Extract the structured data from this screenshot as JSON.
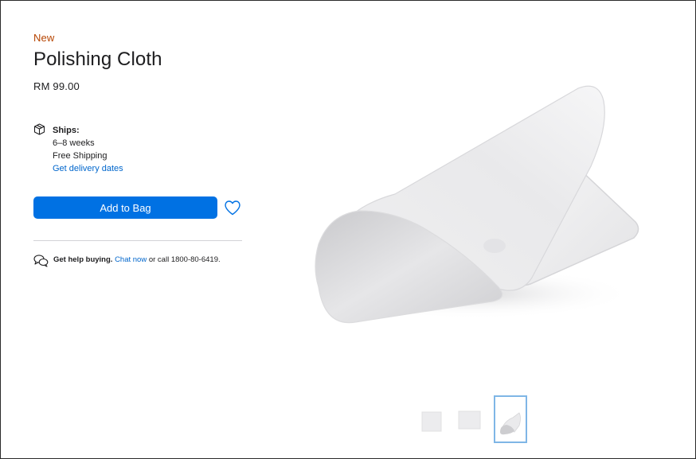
{
  "product": {
    "badge": "New",
    "title": "Polishing Cloth",
    "price": "RM 99.00"
  },
  "shipping": {
    "icon": "box-icon",
    "title": "Ships:",
    "duration": "6–8 weeks",
    "cost": "Free Shipping",
    "delivery_link": "Get delivery dates"
  },
  "actions": {
    "add_to_bag": "Add to Bag",
    "favorite_icon": "heart-icon"
  },
  "help": {
    "icon": "chat-icon",
    "lead": "Get help buying.",
    "chat_link": "Chat now",
    "rest": " or call 1800-80-6419."
  },
  "gallery": {
    "thumbnail_count": 3,
    "selected_thumbnail": 3
  },
  "colors": {
    "badge": "#b64400",
    "primary_button": "#0071e3",
    "link": "#0066cc",
    "text": "#1d1d1f",
    "selected_thumb_border": "#7fb6e6"
  }
}
